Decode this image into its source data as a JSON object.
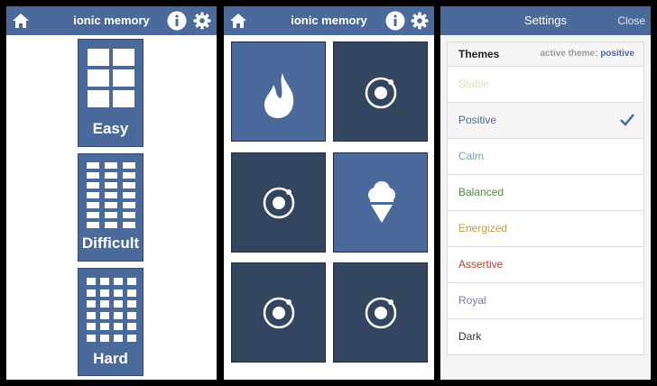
{
  "header": {
    "title": "ionic memory"
  },
  "difficulty": [
    {
      "label": "Easy"
    },
    {
      "label": "Difficult"
    },
    {
      "label": "Hard"
    }
  ],
  "cards": [
    {
      "state": "face-up",
      "icon": "flame-icon"
    },
    {
      "state": "face-down",
      "icon": "ionic-logo-icon"
    },
    {
      "state": "face-down",
      "icon": "ionic-logo-icon"
    },
    {
      "state": "face-up",
      "icon": "ice-cream-icon"
    },
    {
      "state": "face-down",
      "icon": "ionic-logo-icon"
    },
    {
      "state": "face-down",
      "icon": "ionic-logo-icon"
    }
  ],
  "settings": {
    "title": "Settings",
    "close_label": "Close",
    "themes_title": "Themes",
    "active_theme_label": "active theme:",
    "active_theme": "positive",
    "themes": [
      {
        "label": "Stable",
        "color": "#e6ddc0"
      },
      {
        "label": "Positive",
        "color": "#4a6a9b",
        "selected": true
      },
      {
        "label": "Calm",
        "color": "#6fa7b3"
      },
      {
        "label": "Balanced",
        "color": "#4f8a3a"
      },
      {
        "label": "Energized",
        "color": "#c9973c"
      },
      {
        "label": "Assertive",
        "color": "#c2392b"
      },
      {
        "label": "Royal",
        "color": "#7e74a8"
      },
      {
        "label": "Dark",
        "color": "#333333"
      }
    ]
  },
  "colors": {
    "header": "#4a6a9b",
    "card_up": "#4a6a9b",
    "card_down": "#33465f"
  }
}
